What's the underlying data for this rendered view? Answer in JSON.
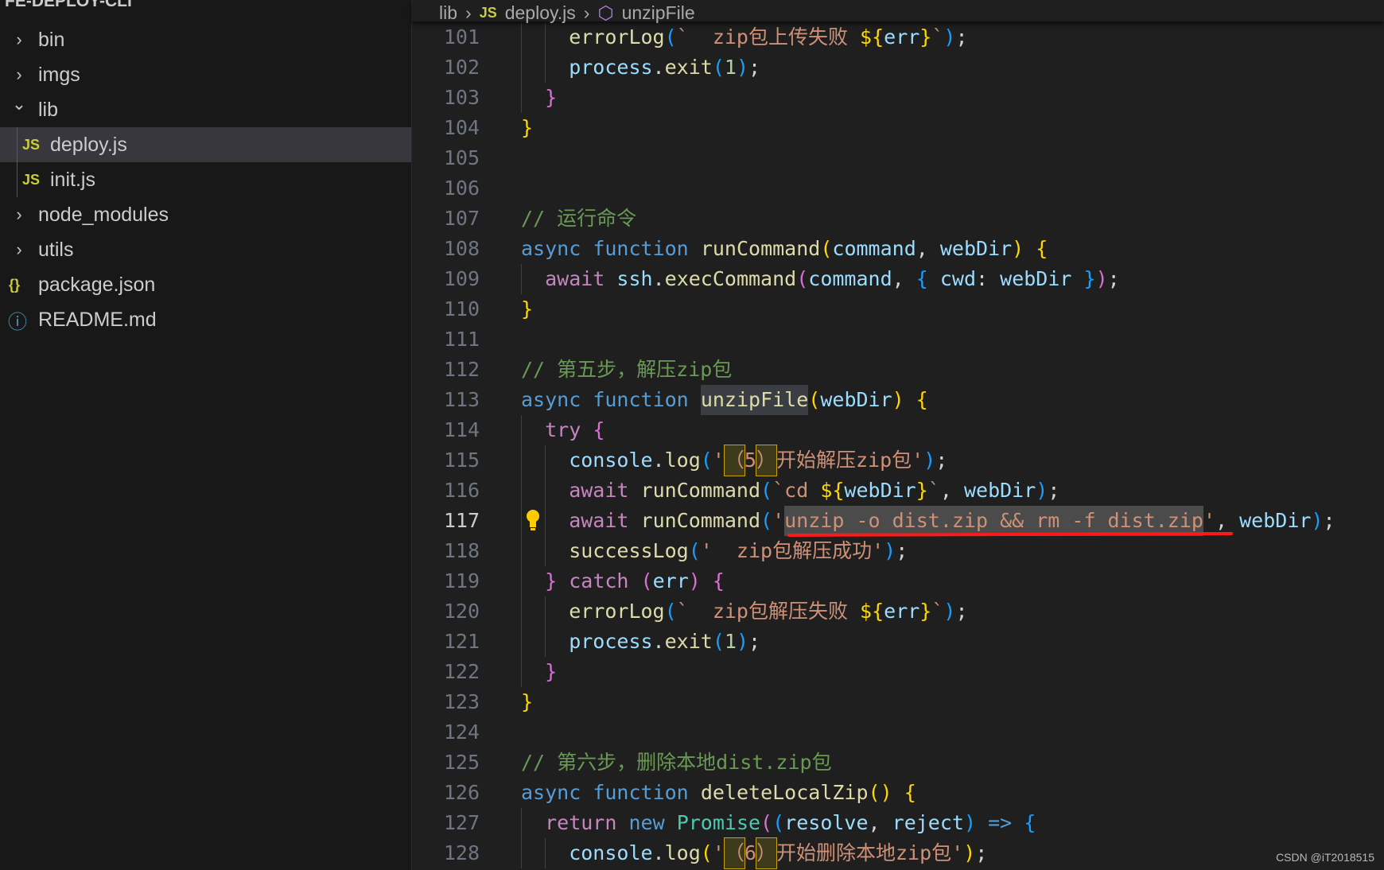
{
  "explorer": {
    "root": "FE-DEPLOY-CLI",
    "items": [
      {
        "label": "bin",
        "type": "folder",
        "expanded": false
      },
      {
        "label": "imgs",
        "type": "folder",
        "expanded": false
      },
      {
        "label": "lib",
        "type": "folder",
        "expanded": true
      },
      {
        "label": "deploy.js",
        "type": "js",
        "selected": true
      },
      {
        "label": "init.js",
        "type": "js"
      },
      {
        "label": "node_modules",
        "type": "folder",
        "expanded": false
      },
      {
        "label": "utils",
        "type": "folder",
        "expanded": false
      },
      {
        "label": "package.json",
        "type": "json"
      },
      {
        "label": "README.md",
        "type": "info"
      }
    ],
    "js_icon": "JS",
    "json_icon": "{}",
    "info_icon": "ⓘ"
  },
  "breadcrumb": {
    "items": [
      "lib",
      "deploy.js",
      "unzipFile"
    ],
    "js_icon": "JS"
  },
  "editor": {
    "active_line": 117,
    "lines": [
      {
        "n": 101,
        "indent": 2,
        "t": [
          [
            "fn",
            "errorLog"
          ],
          [
            "b3",
            "("
          ],
          [
            "str",
            "`  zip包上传失败 "
          ],
          [
            "b1",
            "${"
          ],
          [
            "var",
            "err"
          ],
          [
            "b1",
            "}"
          ],
          [
            "str",
            "`"
          ],
          [
            "b3",
            ")"
          ],
          [
            "p",
            ";"
          ]
        ]
      },
      {
        "n": 102,
        "indent": 2,
        "t": [
          [
            "var",
            "process"
          ],
          [
            "p",
            "."
          ],
          [
            "fn",
            "exit"
          ],
          [
            "b3",
            "("
          ],
          [
            "num",
            "1"
          ],
          [
            "b3",
            ")"
          ],
          [
            "p",
            ";"
          ]
        ]
      },
      {
        "n": 103,
        "indent": 1,
        "t": [
          [
            "b2",
            "}"
          ]
        ]
      },
      {
        "n": 104,
        "indent": 0,
        "t": [
          [
            "b1",
            "}"
          ]
        ]
      },
      {
        "n": 105,
        "indent": 0,
        "t": []
      },
      {
        "n": 106,
        "indent": 0,
        "t": []
      },
      {
        "n": 107,
        "indent": 0,
        "t": [
          [
            "cm",
            "// 运行命令"
          ]
        ]
      },
      {
        "n": 108,
        "indent": 0,
        "t": [
          [
            "kw",
            "async"
          ],
          [
            "p",
            " "
          ],
          [
            "kw",
            "function"
          ],
          [
            "p",
            " "
          ],
          [
            "fn",
            "runCommand"
          ],
          [
            "b1",
            "("
          ],
          [
            "var",
            "command"
          ],
          [
            "p",
            ", "
          ],
          [
            "var",
            "webDir"
          ],
          [
            "b1",
            ")"
          ],
          [
            "p",
            " "
          ],
          [
            "b1",
            "{"
          ]
        ]
      },
      {
        "n": 109,
        "indent": 1,
        "t": [
          [
            "ctl",
            "await"
          ],
          [
            "p",
            " "
          ],
          [
            "var",
            "ssh"
          ],
          [
            "p",
            "."
          ],
          [
            "fn",
            "execCommand"
          ],
          [
            "b2",
            "("
          ],
          [
            "var",
            "command"
          ],
          [
            "p",
            ", "
          ],
          [
            "b3",
            "{"
          ],
          [
            "p",
            " "
          ],
          [
            "var",
            "cwd"
          ],
          [
            "p",
            ": "
          ],
          [
            "var",
            "webDir"
          ],
          [
            "p",
            " "
          ],
          [
            "b3",
            "}"
          ],
          [
            "b2",
            ")"
          ],
          [
            "p",
            ";"
          ]
        ]
      },
      {
        "n": 110,
        "indent": 0,
        "t": [
          [
            "b1",
            "}"
          ]
        ]
      },
      {
        "n": 111,
        "indent": 0,
        "t": []
      },
      {
        "n": 112,
        "indent": 0,
        "t": [
          [
            "cm",
            "// 第五步，解压zip包"
          ]
        ]
      },
      {
        "n": 113,
        "indent": 0,
        "t": [
          [
            "kw",
            "async"
          ],
          [
            "p",
            " "
          ],
          [
            "kw",
            "function"
          ],
          [
            "p",
            " "
          ],
          [
            "fn hl",
            "unzipFile"
          ],
          [
            "b1",
            "("
          ],
          [
            "var",
            "webDir"
          ],
          [
            "b1",
            ")"
          ],
          [
            "p",
            " "
          ],
          [
            "b1",
            "{"
          ]
        ]
      },
      {
        "n": 114,
        "indent": 1,
        "t": [
          [
            "ctl",
            "try"
          ],
          [
            "p",
            " "
          ],
          [
            "b2",
            "{"
          ]
        ]
      },
      {
        "n": 115,
        "indent": 2,
        "t": [
          [
            "var",
            "console"
          ],
          [
            "p",
            "."
          ],
          [
            "fn",
            "log"
          ],
          [
            "b3",
            "("
          ],
          [
            "str",
            "'"
          ],
          [
            "str uni",
            "（"
          ],
          [
            "str",
            "5"
          ],
          [
            "str uni",
            "）"
          ],
          [
            "str",
            "开始解压zip包'"
          ],
          [
            "b3",
            ")"
          ],
          [
            "p",
            ";"
          ]
        ]
      },
      {
        "n": 116,
        "indent": 2,
        "t": [
          [
            "ctl",
            "await"
          ],
          [
            "p",
            " "
          ],
          [
            "fn",
            "runCommand"
          ],
          [
            "b3",
            "("
          ],
          [
            "str",
            "`cd "
          ],
          [
            "b1",
            "${"
          ],
          [
            "var",
            "webDir"
          ],
          [
            "b1",
            "}"
          ],
          [
            "str",
            "`"
          ],
          [
            "p",
            ", "
          ],
          [
            "var",
            "webDir"
          ],
          [
            "b3",
            ")"
          ],
          [
            "p",
            ";"
          ]
        ]
      },
      {
        "n": 117,
        "indent": 2,
        "t": [
          [
            "ctl",
            "await"
          ],
          [
            "p",
            " "
          ],
          [
            "fn",
            "runCommand"
          ],
          [
            "b3",
            "("
          ],
          [
            "str",
            "'"
          ],
          [
            "str sel",
            "unzip -o dist.zip && rm -f dist.zip"
          ],
          [
            "str",
            "'"
          ],
          [
            "p",
            ", "
          ],
          [
            "var",
            "webDir"
          ],
          [
            "b3",
            ")"
          ],
          [
            "p",
            ";"
          ]
        ]
      },
      {
        "n": 118,
        "indent": 2,
        "t": [
          [
            "fn",
            "successLog"
          ],
          [
            "b3",
            "("
          ],
          [
            "str",
            "'  zip包解压成功'"
          ],
          [
            "b3",
            ")"
          ],
          [
            "p",
            ";"
          ]
        ]
      },
      {
        "n": 119,
        "indent": 1,
        "t": [
          [
            "b2",
            "}"
          ],
          [
            "p",
            " "
          ],
          [
            "ctl",
            "catch"
          ],
          [
            "p",
            " "
          ],
          [
            "b2",
            "("
          ],
          [
            "var",
            "err"
          ],
          [
            "b2",
            ")"
          ],
          [
            "p",
            " "
          ],
          [
            "b2",
            "{"
          ]
        ]
      },
      {
        "n": 120,
        "indent": 2,
        "t": [
          [
            "fn",
            "errorLog"
          ],
          [
            "b3",
            "("
          ],
          [
            "str",
            "`  zip包解压失败 "
          ],
          [
            "b1",
            "${"
          ],
          [
            "var",
            "err"
          ],
          [
            "b1",
            "}"
          ],
          [
            "str",
            "`"
          ],
          [
            "b3",
            ")"
          ],
          [
            "p",
            ";"
          ]
        ]
      },
      {
        "n": 121,
        "indent": 2,
        "t": [
          [
            "var",
            "process"
          ],
          [
            "p",
            "."
          ],
          [
            "fn",
            "exit"
          ],
          [
            "b3",
            "("
          ],
          [
            "num",
            "1"
          ],
          [
            "b3",
            ")"
          ],
          [
            "p",
            ";"
          ]
        ]
      },
      {
        "n": 122,
        "indent": 1,
        "t": [
          [
            "b2",
            "}"
          ]
        ]
      },
      {
        "n": 123,
        "indent": 0,
        "t": [
          [
            "b1",
            "}"
          ]
        ]
      },
      {
        "n": 124,
        "indent": 0,
        "t": []
      },
      {
        "n": 125,
        "indent": 0,
        "t": [
          [
            "cm",
            "// 第六步，删除本地dist.zip包"
          ]
        ]
      },
      {
        "n": 126,
        "indent": 0,
        "t": [
          [
            "kw",
            "async"
          ],
          [
            "p",
            " "
          ],
          [
            "kw",
            "function"
          ],
          [
            "p",
            " "
          ],
          [
            "fn",
            "deleteLocalZip"
          ],
          [
            "b1",
            "()"
          ],
          [
            "p",
            " "
          ],
          [
            "b1",
            "{"
          ]
        ]
      },
      {
        "n": 127,
        "indent": 1,
        "t": [
          [
            "ctl",
            "return"
          ],
          [
            "p",
            " "
          ],
          [
            "kw",
            "new"
          ],
          [
            "p",
            " "
          ],
          [
            "cls",
            "Promise"
          ],
          [
            "b2",
            "("
          ],
          [
            "b3",
            "("
          ],
          [
            "var",
            "resolve"
          ],
          [
            "p",
            ", "
          ],
          [
            "var",
            "reject"
          ],
          [
            "b3",
            ")"
          ],
          [
            "p",
            " "
          ],
          [
            "kw",
            "=>"
          ],
          [
            "p",
            " "
          ],
          [
            "b3",
            "{"
          ]
        ]
      },
      {
        "n": 128,
        "indent": 2,
        "t": [
          [
            "var",
            "console"
          ],
          [
            "p",
            "."
          ],
          [
            "fn",
            "log"
          ],
          [
            "b1",
            "("
          ],
          [
            "str",
            "'"
          ],
          [
            "str uni",
            "（"
          ],
          [
            "str",
            "6"
          ],
          [
            "str uni",
            "）"
          ],
          [
            "str",
            "开始删除本地zip包'"
          ],
          [
            "b1",
            ")"
          ],
          [
            "p",
            ";"
          ]
        ]
      }
    ],
    "lightbulb_line": 117
  },
  "watermark": "CSDN @iT2018515"
}
